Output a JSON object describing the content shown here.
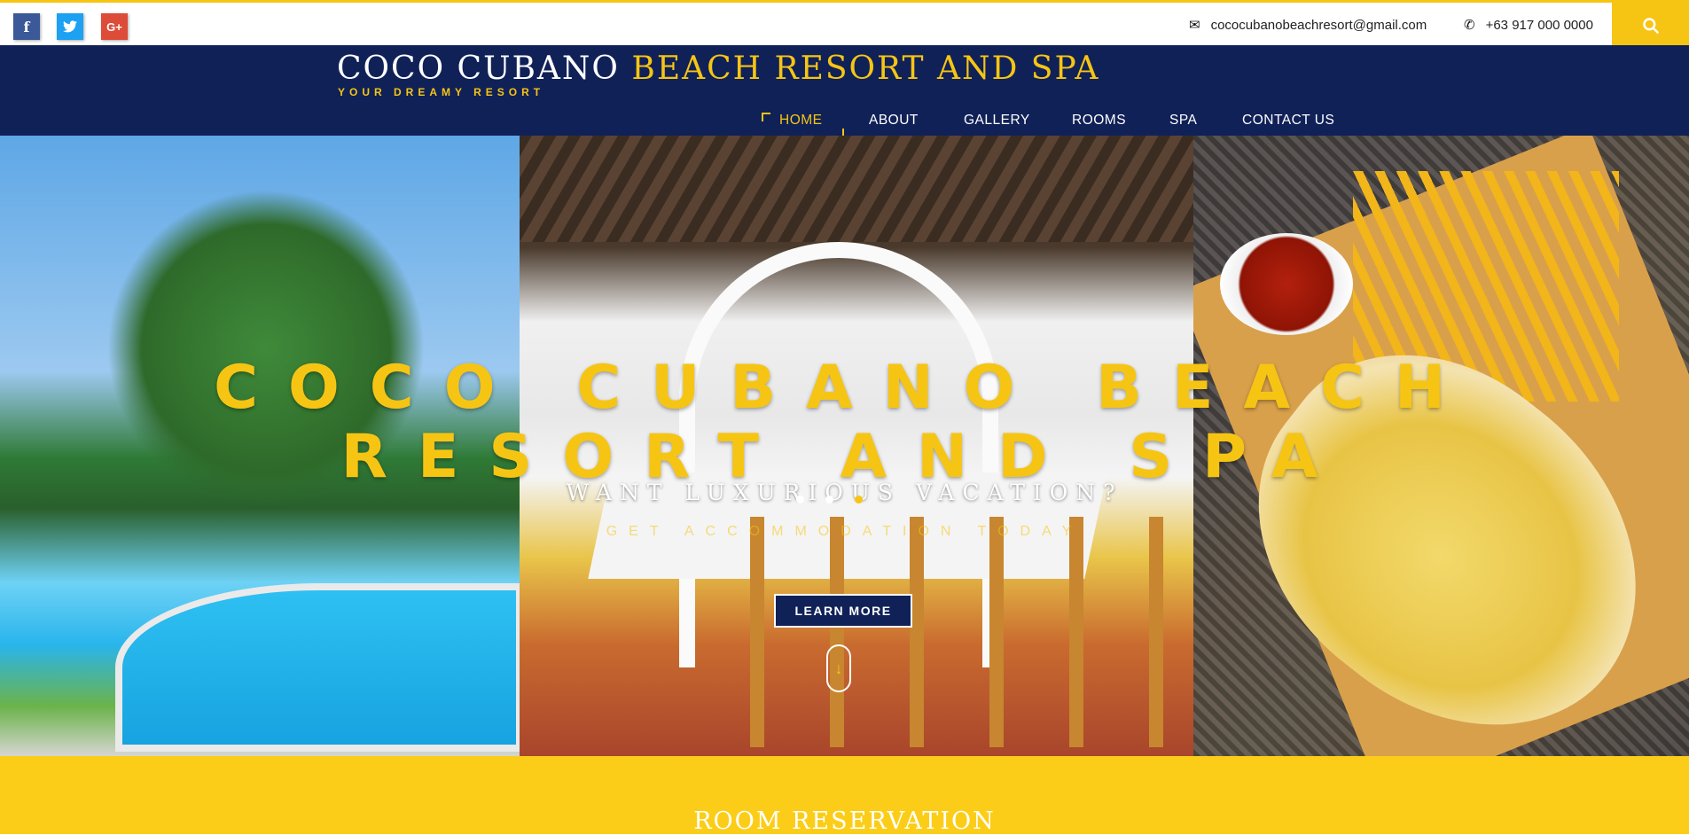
{
  "topbar": {
    "social": [
      {
        "label": "f",
        "icon": "facebook-icon"
      },
      {
        "label": "t",
        "icon": "twitter-icon"
      },
      {
        "label": "G+",
        "icon": "google-plus-icon"
      }
    ],
    "email": "cococubanobeachresort@gmail.com",
    "phone": "+63 917 000 0000",
    "accent": "#f6c514"
  },
  "header": {
    "brand_white": "COCO CUBANO",
    "brand_yellow": "BEACH RESORT AND SPA",
    "tagline": "YOUR DREAMY RESORT",
    "bg_color": "#102158"
  },
  "nav": {
    "items": [
      {
        "label": "HOME",
        "active": true
      },
      {
        "label": "ABOUT"
      },
      {
        "label": "GALLERY"
      },
      {
        "label": "ROOMS"
      },
      {
        "label": "SPA"
      },
      {
        "label": "CONTACT US"
      }
    ]
  },
  "hero": {
    "title_line1": "COCO CUBANO BEACH",
    "title_line2": "RESORT AND SPA",
    "subtitle": "WANT LUXURIOUS VACATION?",
    "subtitle2": "GET ACCOMMODATION TODAY",
    "button": "LEARN MORE",
    "scroll_icon": "arrow-down-icon",
    "slides": 3,
    "active_slide": 3
  },
  "reservation": {
    "title": "ROOM RESERVATION",
    "bg_color": "#fccd18"
  }
}
